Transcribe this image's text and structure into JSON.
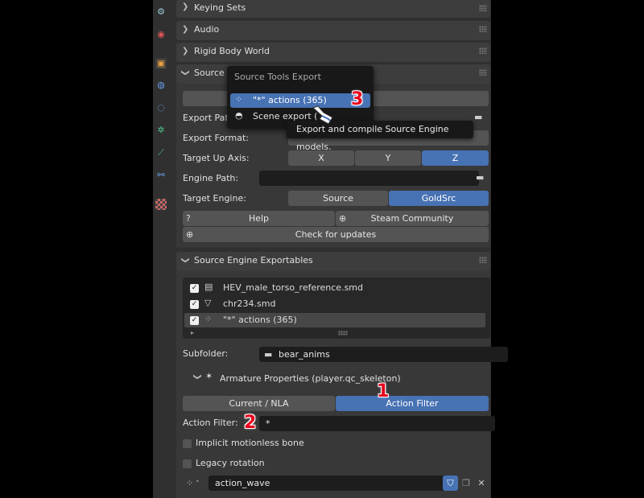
{
  "sidebar": {
    "icons": [
      "physics-icon",
      "world-icon",
      "object-icon",
      "modifier-icon",
      "particles-icon",
      "constraint-icon",
      "bone-icon",
      "bone-constraint-icon",
      "texture-icon"
    ]
  },
  "panels": {
    "keying_sets": "Keying Sets",
    "audio": "Audio",
    "rigid_body_world": "Rigid Body World",
    "source_engine_export": "Source E",
    "exportables": "Source Engine Exportables"
  },
  "export_panel": {
    "export_path_label": "Export Path",
    "export_format_label": "Export Format:",
    "up_axis_label": "Target Up Axis:",
    "axes": [
      "X",
      "Y",
      "Z"
    ],
    "active_axis": "Z",
    "engine_path_label": "Engine Path:",
    "engine_path_value": "",
    "target_engine_label": "Target Engine:",
    "engines": [
      "Source",
      "GoldSrc"
    ],
    "active_engine": "GoldSrc",
    "help_label": "Help",
    "community_label": "Steam Community",
    "updates_label": "Check for updates"
  },
  "popup": {
    "title": "Source Tools Export",
    "items": [
      "\"*\" actions (365)",
      "Scene export (365)"
    ],
    "item2_visible": "Scene export ("
  },
  "tooltip": {
    "text": "Export and compile Source Engine models."
  },
  "exportables": {
    "items": [
      {
        "name": "HEV_male_torso_reference.smd",
        "checked": true,
        "icon": "collection-icon"
      },
      {
        "name": "chr234.smd",
        "checked": true,
        "icon": "mesh-icon"
      },
      {
        "name": "\"*\" actions (365)",
        "checked": true,
        "icon": "action-icon"
      }
    ],
    "subfolder_label": "Subfolder:",
    "subfolder_value": "bear_anims",
    "armature_label": "Armature Properties (player.qc_skeleton)",
    "tabs": [
      "Current / NLA",
      "Action Filter"
    ],
    "active_tab": "Action Filter",
    "action_filter_label": "Action Filter:",
    "action_filter_value": "*",
    "implicit_label": "Implicit motionless bone",
    "legacy_label": "Legacy rotation",
    "action_value": "action_wave"
  },
  "markers": [
    "1",
    "2",
    "3"
  ]
}
